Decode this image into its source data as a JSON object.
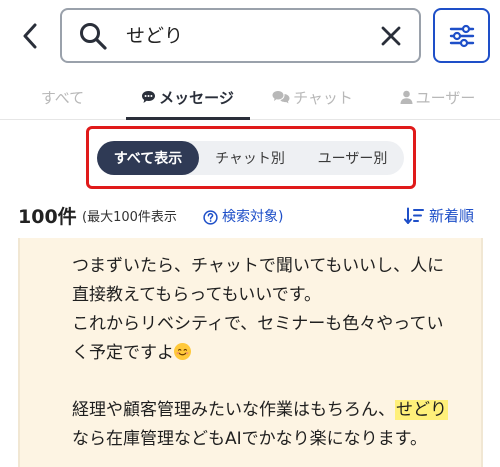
{
  "search": {
    "query": "せどり"
  },
  "tabs": {
    "all": "すべて",
    "messages": "メッセージ",
    "chats": "チャット",
    "users": "ユーザー"
  },
  "segments": {
    "all": "すべて表示",
    "by_chat": "チャット別",
    "by_user": "ユーザー別"
  },
  "results": {
    "count": "100件",
    "max_note": "(最大100件表示",
    "target_link": "検索対象)",
    "sort_label": "新着順"
  },
  "message": {
    "line1": "つまずいたら、チャットで聞いてもいいし、人に",
    "line2": "直接教えてもらってもいいです。",
    "line3": "これからリベシティで、セミナーも色々やってい",
    "line4": "く予定ですよ",
    "line5_pre": "経理や顧客管理みたいな作業はもちろん、",
    "line5_hl": "せどり",
    "line6": "なら在庫管理などもAIでかなり楽になります。"
  },
  "colors": {
    "accent": "#1e4fc8",
    "segment_active": "#2f3a55",
    "highlight_box": "#e01a1a",
    "card_bg": "#fdf4e3",
    "keyword_highlight": "#fff07a"
  },
  "icons": {
    "back": "chevron-left-icon",
    "search": "search-icon",
    "clear": "close-icon",
    "filter": "sliders-icon",
    "messages_tab": "speech-bubble-icon",
    "chats_tab": "chat-bubbles-icon",
    "users_tab": "person-icon",
    "help": "question-circle-icon",
    "sort": "sort-descending-icon",
    "emoji": "smiling-face-icon"
  }
}
